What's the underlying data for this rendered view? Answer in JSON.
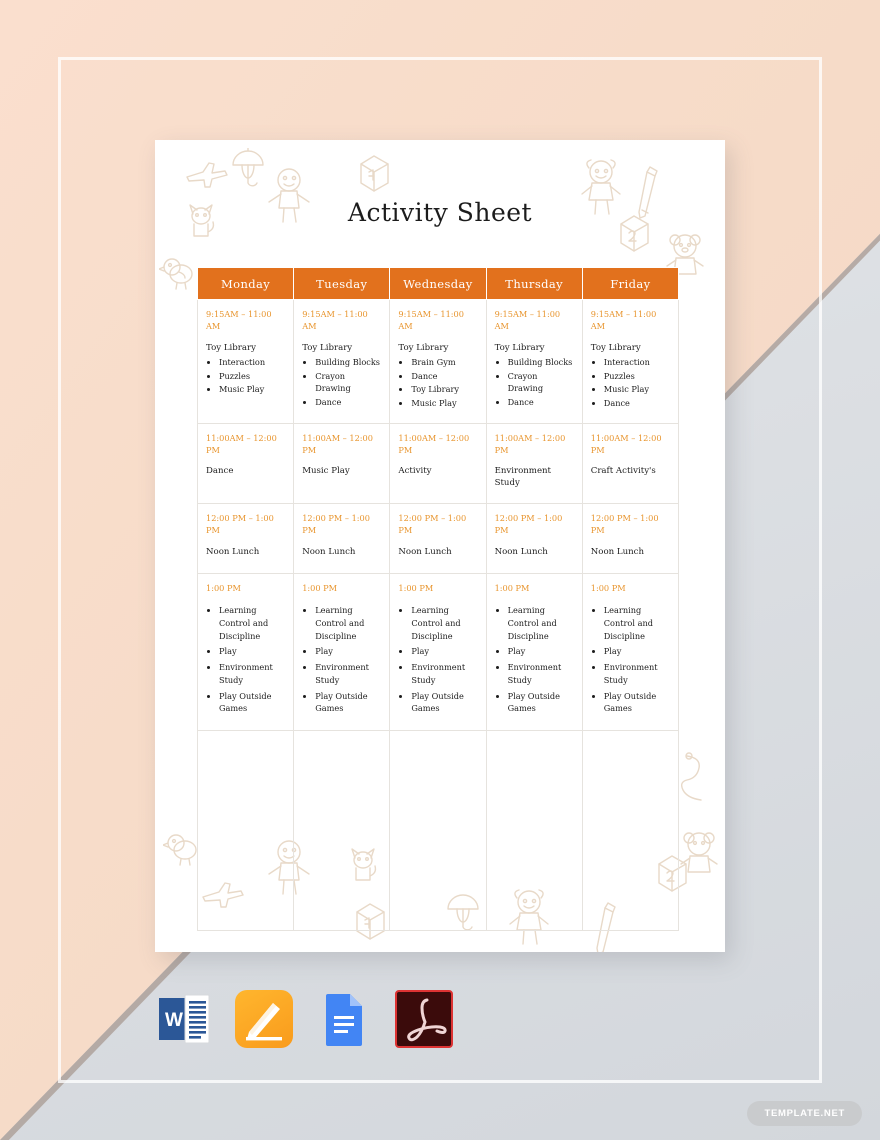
{
  "document": {
    "title": "Activity Sheet"
  },
  "table": {
    "columns": [
      "Monday",
      "Tuesday",
      "Wednesday",
      "Thursday",
      "Friday"
    ],
    "rows": [
      {
        "times": [
          "9:15AM – 11:00 AM",
          "9:15AM – 11:00 AM",
          "9:15AM – 11:00 AM",
          "9:15AM – 11:00 AM",
          "9:15AM – 11:00 AM"
        ],
        "cells": [
          {
            "heading": "Toy Library",
            "items": [
              "Interaction",
              "Puzzles",
              "Music Play"
            ]
          },
          {
            "heading": "Toy Library",
            "items": [
              "Building Blocks",
              "Crayon Drawing",
              "Dance"
            ]
          },
          {
            "heading": "Toy Library",
            "items": [
              "Brain Gym",
              "Dance",
              "Toy Library",
              "Music Play"
            ]
          },
          {
            "heading": "Toy Library",
            "items": [
              "Building Blocks",
              "Crayon Drawing",
              "Dance"
            ]
          },
          {
            "heading": "Toy Library",
            "items": [
              "Interaction",
              "Puzzles",
              "Music Play",
              "Dance"
            ]
          }
        ]
      },
      {
        "times": [
          "11:00AM – 12:00 PM",
          "11:00AM – 12:00 PM",
          "11:00AM – 12:00 PM",
          "11:00AM – 12:00 PM",
          "11:00AM – 12:00 PM"
        ],
        "cells": [
          {
            "heading": "Dance",
            "items": []
          },
          {
            "heading": "Music Play",
            "items": []
          },
          {
            "heading": "Activity",
            "items": []
          },
          {
            "heading": "Environment Study",
            "items": []
          },
          {
            "heading": "Craft Activity's",
            "items": []
          }
        ]
      },
      {
        "times": [
          "12:00 PM – 1:00 PM",
          "12:00 PM – 1:00 PM",
          "12:00 PM – 1:00 PM",
          "12:00 PM – 1:00 PM",
          "12:00 PM – 1:00 PM"
        ],
        "cells": [
          {
            "heading": "Noon Lunch",
            "items": []
          },
          {
            "heading": "Noon Lunch",
            "items": []
          },
          {
            "heading": "Noon Lunch",
            "items": []
          },
          {
            "heading": "Noon Lunch",
            "items": []
          },
          {
            "heading": "Noon Lunch",
            "items": []
          }
        ]
      },
      {
        "times": [
          "1:00 PM",
          "1:00 PM",
          "1:00 PM",
          "1:00 PM",
          "1:00 PM"
        ],
        "cells": [
          {
            "heading": "",
            "items": [
              "Learning Control and Discipline",
              "Play",
              "Environment Study",
              "Play Outside Games"
            ]
          },
          {
            "heading": "",
            "items": [
              "Learning Control and Discipline",
              "Play",
              "Environment Study",
              "Play Outside Games"
            ]
          },
          {
            "heading": "",
            "items": [
              "Learning Control and Discipline",
              "Play",
              "Environment Study",
              "Play Outside Games"
            ]
          },
          {
            "heading": "",
            "items": [
              "Learning Control and Discipline",
              "Play",
              "Environment Study",
              "Play Outside Games"
            ]
          },
          {
            "heading": "",
            "items": [
              "Learning Control and Discipline",
              "Play",
              "Environment Study",
              "Play Outside Games"
            ]
          }
        ]
      }
    ]
  },
  "formats": [
    {
      "name": "microsoft-word",
      "label": "W"
    },
    {
      "name": "apple-pages",
      "label": ""
    },
    {
      "name": "google-docs",
      "label": ""
    },
    {
      "name": "adobe-pdf",
      "label": ""
    }
  ],
  "watermark": {
    "text": "TEMPLATE.NET"
  },
  "colors": {
    "header_orange": "#e2711d",
    "time_orange": "#e8952e",
    "page_background": "#ffffff",
    "backdrop_peach": "#fadfce",
    "backdrop_grey": "#dcdfe3",
    "doodle": "#e8d9c8"
  }
}
